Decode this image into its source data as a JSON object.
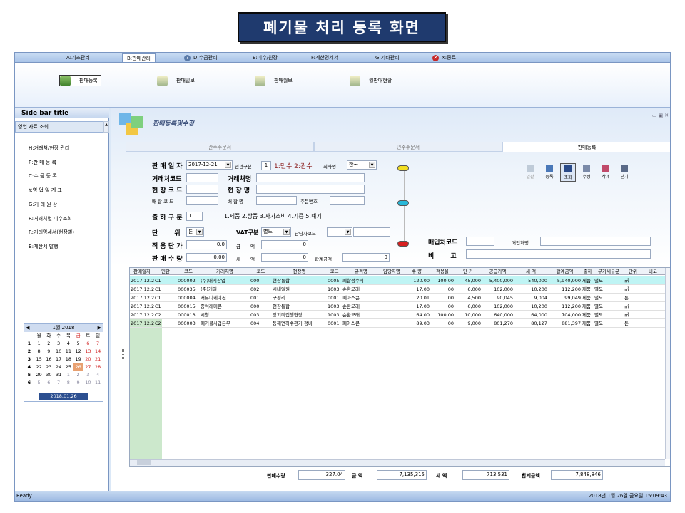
{
  "banner_title": "폐기물 처리 등록 화면",
  "menu": {
    "items": [
      "A:기초관리",
      "B:판매관리",
      "D:수금관리",
      "E:미수/원장",
      "F:계산명세서",
      "G:기타관리",
      "X:종료"
    ],
    "active_index": 1
  },
  "ribbon": {
    "buttons": [
      "판매등록",
      "판매일보",
      "판매월보",
      "월판매현황"
    ],
    "selected_index": 0
  },
  "sidebar": {
    "title": "Side bar title",
    "section": "영업 자료 조회",
    "items": [
      "H:거래처/현장 관리",
      "P:판 매 등 록",
      "C:수 금 등 록",
      "Y:영 업 일 계 표",
      "G:거 래 원 장",
      "R:거래처별 미수조회",
      "R:거래명세서(현장별)",
      "B:계산서 발행"
    ]
  },
  "calendar": {
    "title": "1월 2018",
    "weekdays": [
      "월",
      "화",
      "수",
      "목",
      "금",
      "토",
      "일"
    ],
    "weeks": [
      {
        "num": "1",
        "days": [
          "1",
          "2",
          "3",
          "4",
          "5",
          "6",
          "7"
        ]
      },
      {
        "num": "2",
        "days": [
          "8",
          "9",
          "10",
          "11",
          "12",
          "13",
          "14"
        ]
      },
      {
        "num": "3",
        "days": [
          "15",
          "16",
          "17",
          "18",
          "19",
          "20",
          "21"
        ]
      },
      {
        "num": "4",
        "days": [
          "22",
          "23",
          "24",
          "25",
          "26",
          "27",
          "28"
        ]
      },
      {
        "num": "5",
        "days": [
          "29",
          "30",
          "31",
          "1",
          "2",
          "3",
          "4"
        ]
      },
      {
        "num": "6",
        "days": [
          "5",
          "6",
          "7",
          "8",
          "9",
          "10",
          "11"
        ]
      }
    ],
    "today": "2018.01.26"
  },
  "panel": {
    "title": "판매등록및수정",
    "tabs": [
      "관수주문서",
      "민수주문서",
      "판매등록"
    ],
    "active_tab": 2
  },
  "form": {
    "sale_date_label": "판 매 일 자",
    "sale_date": "2017-12-21",
    "type_label": "민관구분",
    "type_value": "1",
    "type_hint": "1:민수 2:관수",
    "company_label": "회사명",
    "company_value": "한국",
    "client_code_label": "거래처코드",
    "client_name_label": "거래처명",
    "site_code_label": "현 장 코 드",
    "site_name_label": "현 장 명",
    "sale_code_label": "배 합 코 드",
    "sale_name_label": "배 합 명",
    "order_no_label": "주문번호",
    "ship_type_label": "출 하 구 분",
    "ship_type_value": "1",
    "ship_type_hint": "1.제품 2.상품 3.자가소비 4.기증 5.폐기",
    "unit_label": "단 위",
    "unit_value": "톤",
    "vat_label": "VAT구분",
    "vat_value": "별도",
    "staff_label": "담당자코드",
    "unit_price_label": "적 용 단 가",
    "unit_price": "0.0",
    "amount_label": "금 액",
    "amount": "0",
    "qty_label": "판 매 수 량",
    "qty": "0.00",
    "tax_label": "세 액",
    "tax": "0",
    "total_label": "합계금액",
    "total": "0",
    "supplier_code_label": "매입처코드",
    "supplier_name_label": "매입처명",
    "note_label": "비 고"
  },
  "toolbar": [
    "일괄",
    "등록",
    "조회",
    "수정",
    "삭제",
    "닫기"
  ],
  "toolbar_selected": 2,
  "grid": {
    "headers": [
      "판매일자",
      "민관",
      "코드",
      "거래처명",
      "코드",
      "현장명",
      "코드",
      "규격명",
      "담당자명",
      "수 량",
      "적용율",
      "단 가",
      "공급가액",
      "세 액",
      "합계금액",
      "출하",
      "부가세구분",
      "단위",
      "비고"
    ],
    "rows": [
      [
        "2017.12.21",
        "C1",
        "000002",
        "(주)대지산업",
        "000",
        "현장통합",
        "0005",
        "폐합성수지",
        "",
        "120.00",
        "100.00",
        "45,000",
        "5,400,000",
        "540,000",
        "5,940,000",
        "제품",
        "별도",
        "㎥",
        ""
      ],
      [
        "2017.12.21",
        "C1",
        "000035",
        "(주)거일",
        "002",
        "시내일원",
        "1003",
        "순환모래",
        "",
        "17.00",
        ".00",
        "6,000",
        "102,000",
        "10,200",
        "112,200",
        "제품",
        "별도",
        "㎥",
        ""
      ],
      [
        "2017.12.21",
        "C1",
        "000004",
        "커뮤니케이션",
        "001",
        "구정리",
        "0001",
        "폐아스콘",
        "",
        "20.01",
        ".00",
        "4,500",
        "90,045",
        "9,004",
        "99,049",
        "제품",
        "별도",
        "톤",
        ""
      ],
      [
        "2017.12.21",
        "C1",
        "000015",
        "종석레미콘",
        "000",
        "현장통합",
        "1003",
        "순환모래",
        "",
        "17.00",
        ".00",
        "6,000",
        "102,000",
        "10,200",
        "112,200",
        "제품",
        "별도",
        "㎥",
        ""
      ],
      [
        "2017.12.21",
        "C2",
        "000013",
        "시청",
        "003",
        "장기미집행현장",
        "1003",
        "순환모래",
        "",
        "64.00",
        "100.00",
        "10,000",
        "640,000",
        "64,000",
        "704,000",
        "제품",
        "별도",
        "㎥",
        ""
      ],
      [
        "2017.12.21",
        "C2",
        "000003",
        "폐기물사업본부",
        "004",
        "동해면하수관거 정비",
        "0001",
        "폐아스콘",
        "",
        "89.03",
        ".00",
        "9,000",
        "801,270",
        "80,127",
        "881,397",
        "제품",
        "별도",
        "톤",
        ""
      ]
    ]
  },
  "summary": {
    "qty_label": "판매수량",
    "qty": "327.04",
    "amount_label": "금 액",
    "amount": "7,135,315",
    "tax_label": "세 액",
    "tax": "713,531",
    "total_label": "합계금액",
    "total": "7,848,846"
  },
  "status": {
    "left": "Ready",
    "right": "2018년 1월 26일 금요일 15:09:43"
  },
  "colors": {
    "banner": "#1f3a6e",
    "selected_row": "#bff4f4",
    "sunday": "#d02020",
    "today": "#e8a070"
  }
}
